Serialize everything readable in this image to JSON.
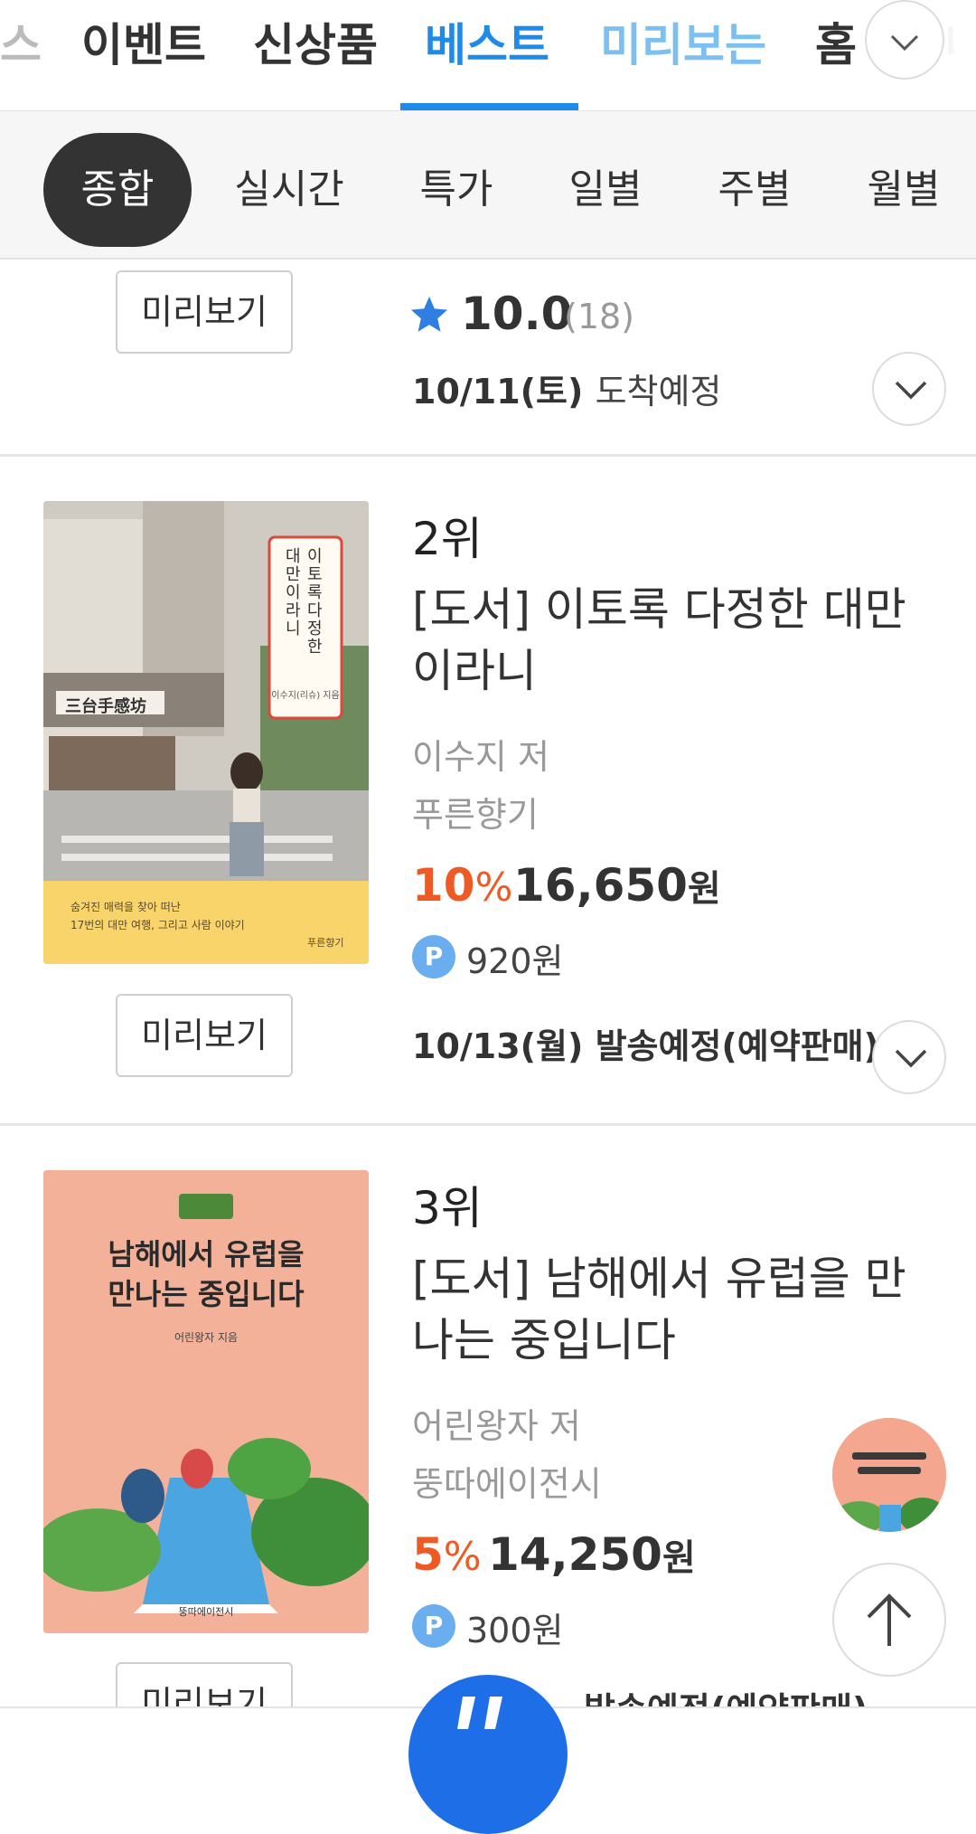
{
  "top_tabs": {
    "items": [
      "스",
      "이벤트",
      "신상품",
      "베스트",
      "미리보는",
      "홈"
    ],
    "active": "베스트",
    "trailing_partial": "나"
  },
  "sub_tabs": [
    "종합",
    "실시간",
    "특가",
    "일별",
    "주별",
    "월별"
  ],
  "item1": {
    "preview_label": "미리보기",
    "rating": "10.0",
    "rating_count": "(18)",
    "delivery_date": "10/11(토)",
    "delivery_status": "도착예정"
  },
  "item2": {
    "rank": "2위",
    "title": "[도서] 이토록 다정한 대만이라니",
    "author": "이수지 저",
    "publisher": "푸른향기",
    "discount_value": "10",
    "discount_unit": "%",
    "price_value": "16,650",
    "price_unit": "원",
    "points": "920원",
    "shipping_date": "10/13(월)",
    "shipping_status": "발송예정(예약판매)",
    "preview_label": "미리보기",
    "cover": {
      "title_vertical_1": "이토록 다정한",
      "title_vertical_2": "대만이라니",
      "author": "이수지(리슈) 지음",
      "tagline_1": "숨겨진 매력을 찾아 떠난",
      "tagline_2": "17번의 대만 여행, 그리고 사람 이야기",
      "shop_sign": "三台手感坊",
      "publisher_logo": "푸른향기"
    }
  },
  "item3": {
    "rank": "3위",
    "title": "[도서] 남해에서 유럽을 만나는 중입니다",
    "author": "어린왕자 저",
    "publisher": "뚱따에이전시",
    "discount_value": "5",
    "discount_unit": "%",
    "price_value": "14,250",
    "price_unit": "원",
    "points": "300원",
    "shipping_status": "발송예정(예약판매)",
    "preview_label": "미리보기",
    "cover": {
      "title_1": "남해에서 유럽을",
      "title_2": "만나는 중입니다",
      "author": "어린왕자 지음",
      "publisher": "뚱따에이전시"
    }
  },
  "badges": {
    "points_letter": "P"
  },
  "colors": {
    "accent": "#1f8be8",
    "discount": "#ee5a24",
    "points": "#6aaef0",
    "fab": "#1e6ee8"
  },
  "icons": [
    "chevron-down-icon",
    "star-icon",
    "arrow-up-icon"
  ]
}
